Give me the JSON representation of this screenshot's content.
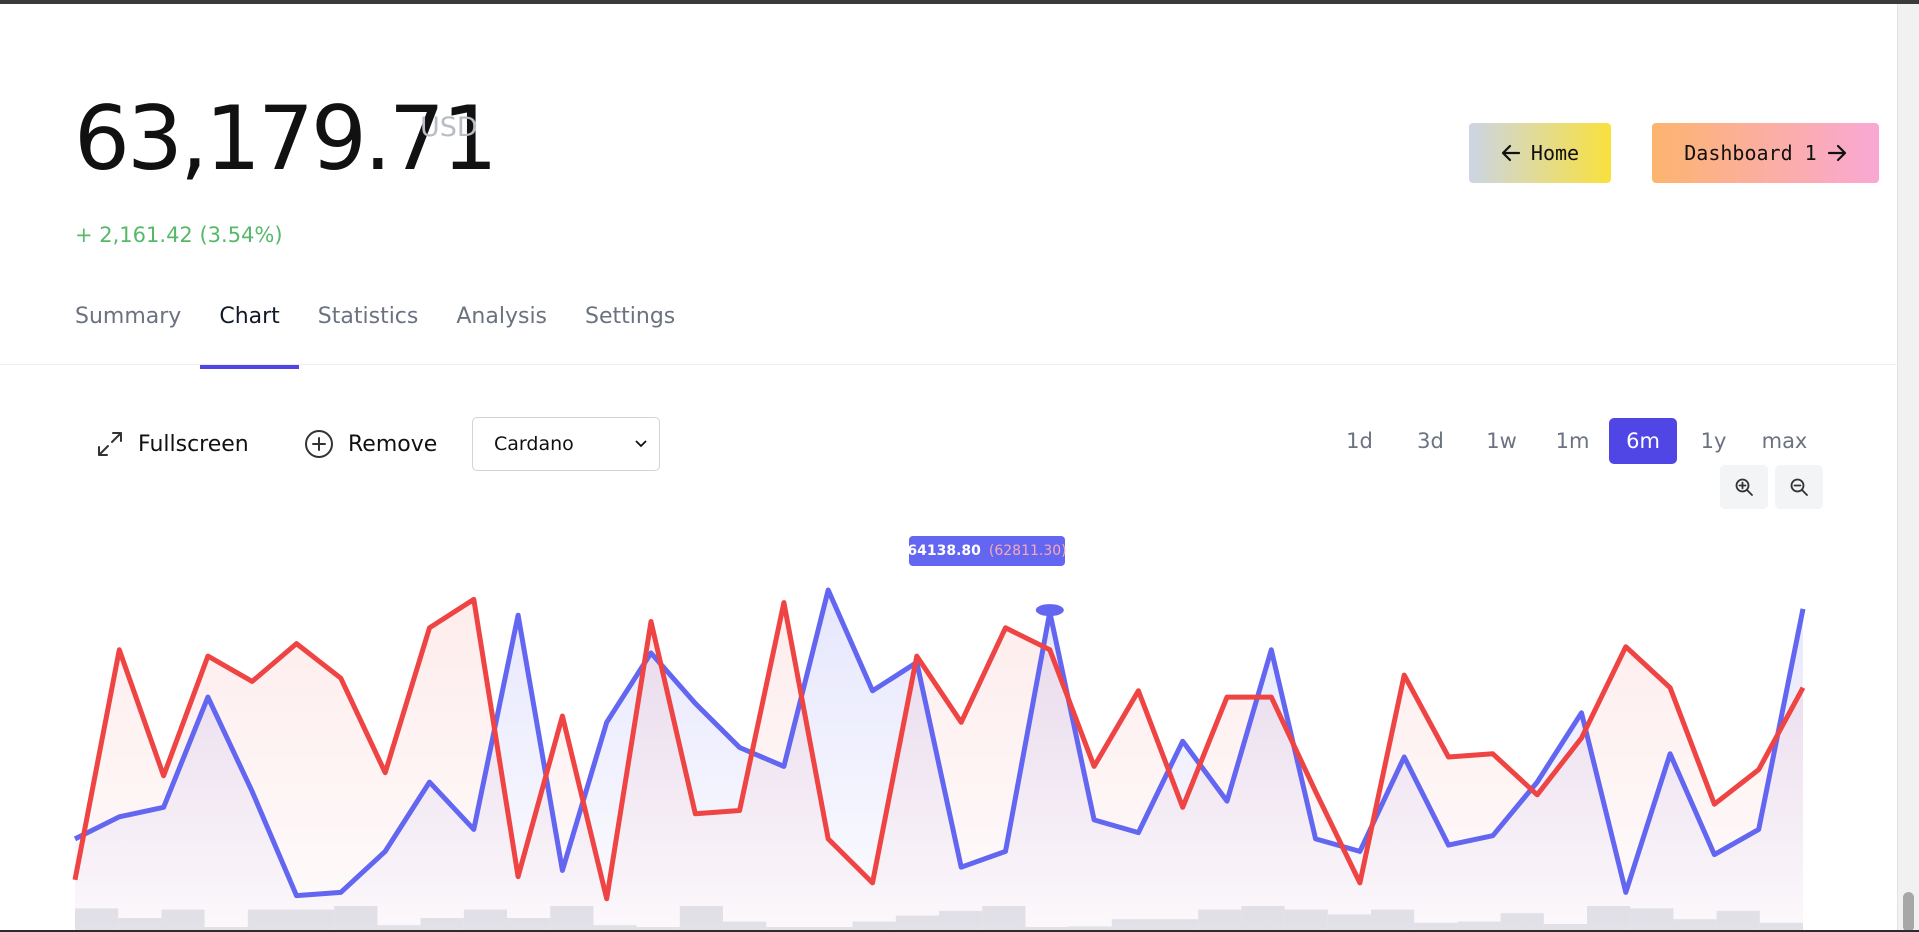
{
  "header": {
    "price": "63,179.71",
    "currency": "USD",
    "change": "+ 2,161.42 (3.54%)"
  },
  "nav_buttons": {
    "home": "Home",
    "dashboard": "Dashboard 1"
  },
  "tabs": [
    {
      "label": "Summary",
      "active": false
    },
    {
      "label": "Chart",
      "active": true
    },
    {
      "label": "Statistics",
      "active": false
    },
    {
      "label": "Analysis",
      "active": false
    },
    {
      "label": "Settings",
      "active": false
    }
  ],
  "toolbar": {
    "fullscreen": "Fullscreen",
    "remove": "Remove",
    "asset_select": "Cardano"
  },
  "ranges": [
    "1d",
    "3d",
    "1w",
    "1m",
    "6m",
    "1y",
    "max"
  ],
  "active_range": "6m",
  "icons": {
    "fullscreen": "expand-icon",
    "remove": "plus-circle-icon",
    "zoom_in": "zoom-in-icon",
    "zoom_out": "zoom-out-icon",
    "home": "arrow-left-icon",
    "dashboard": "arrow-right-icon"
  },
  "colors": {
    "accent": "#4f46e5",
    "positive": "#58b86a",
    "series_blue": "#6366f1",
    "series_red": "#ef4444"
  },
  "tooltip": {
    "value": "64138.80",
    "compare": "(62811.30)"
  },
  "chart_data": {
    "type": "area",
    "grid": false,
    "series": [
      {
        "values": [
          0.21,
          0.28,
          0.31,
          0.66,
          0.36,
          0.03,
          0.04,
          0.17,
          0.39,
          0.24,
          0.92,
          0.11,
          0.58,
          0.8,
          0.64,
          0.5,
          0.44,
          1.0,
          0.68,
          0.77,
          0.12,
          0.17,
          0.93,
          0.27,
          0.23,
          0.52,
          0.33,
          0.81,
          0.21,
          0.17,
          0.47,
          0.19,
          0.22,
          0.39,
          0.61,
          0.04,
          0.48,
          0.16,
          0.24,
          0.94
        ]
      },
      {
        "values": [
          0.08,
          0.81,
          0.41,
          0.79,
          0.71,
          0.83,
          0.72,
          0.42,
          0.88,
          0.97,
          0.09,
          0.6,
          0.02,
          0.9,
          0.29,
          0.3,
          0.96,
          0.21,
          0.07,
          0.79,
          0.58,
          0.88,
          0.81,
          0.44,
          0.68,
          0.31,
          0.66,
          0.66,
          0.36,
          0.07,
          0.73,
          0.47,
          0.48,
          0.35,
          0.53,
          0.82,
          0.69,
          0.32,
          0.43,
          0.69
        ]
      }
    ],
    "volume": [
      0.9,
      0.5,
      0.85,
      0.1,
      0.85,
      0.85,
      1.0,
      0.2,
      0.5,
      0.85,
      0.5,
      1.0,
      0.2,
      0.1,
      1.0,
      0.35,
      0.1,
      0.05,
      0.35,
      0.6,
      0.8,
      1.0,
      0.1,
      0.15,
      0.45,
      0.45,
      0.85,
      1.0,
      0.85,
      0.65,
      0.85,
      0.3,
      0.35,
      0.7,
      0.25,
      1.0,
      0.9,
      0.45,
      0.8,
      0.3
    ]
  }
}
